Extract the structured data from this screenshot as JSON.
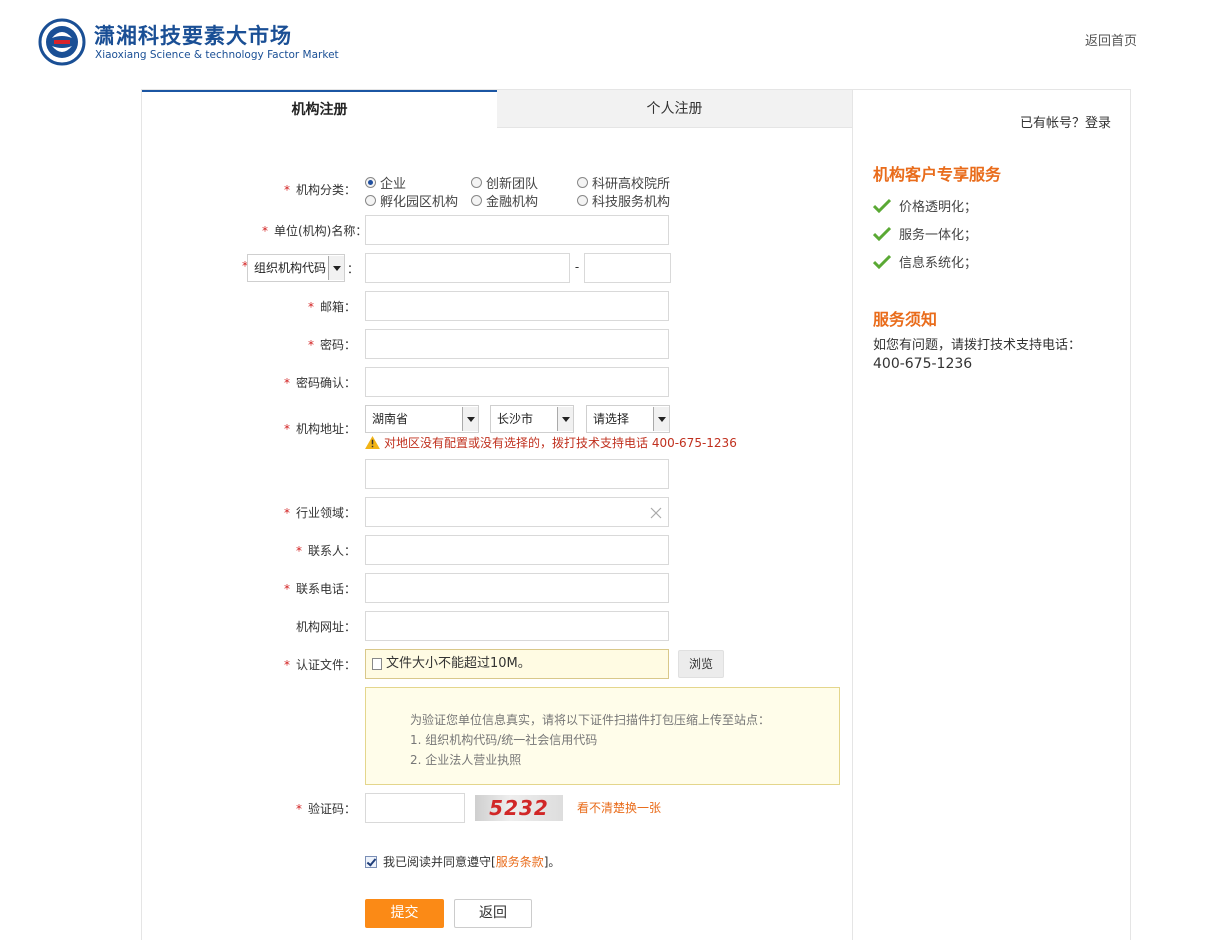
{
  "header": {
    "logo_cn": "潇湘科技要素大市场",
    "logo_en": "Xiaoxiang Science & technology Factor Market",
    "back_home": "返回首页"
  },
  "tabs": [
    {
      "label": "机构注册",
      "active": true
    },
    {
      "label": "个人注册",
      "active": false
    }
  ],
  "form": {
    "required_mark": "*",
    "category": {
      "label": "机构分类：",
      "options": [
        "企业",
        "创新团队",
        "科研高校院所",
        "孵化园区机构",
        "金融机构",
        "科技服务机构"
      ],
      "selected": "企业"
    },
    "unit_name": {
      "label": "单位(机构)名称：",
      "value": ""
    },
    "org_code": {
      "select_value": "组织机构代码",
      "colon": "：",
      "separator": "-",
      "value1": "",
      "value2": ""
    },
    "email": {
      "label": "邮箱：",
      "value": ""
    },
    "password": {
      "label": "密码：",
      "value": ""
    },
    "password_confirm": {
      "label": "密码确认：",
      "value": ""
    },
    "address": {
      "label": "机构地址：",
      "province": "湖南省",
      "city": "长沙市",
      "district": "请选择",
      "warning": "对地区没有配置或没有选择的，拨打技术支持电话 400-675-1236",
      "detail_value": ""
    },
    "industry": {
      "label": "行业领域：",
      "value": ""
    },
    "contact": {
      "label": "联系人：",
      "value": ""
    },
    "phone": {
      "label": "联系电话：",
      "value": ""
    },
    "website": {
      "label": "机构网址：",
      "value": ""
    },
    "cert_file": {
      "label": "认证文件：",
      "placeholder": "文件大小不能超过10M。",
      "browse": "浏览"
    },
    "notice": {
      "line1": "为验证您单位信息真实，请将以下证件扫描件打包压缩上传至站点：",
      "line2": "1. 组织机构代码/统一社会信用代码",
      "line3": "2. 企业法人营业执照"
    },
    "captcha": {
      "label": "验证码：",
      "value": "",
      "image_text": "5232",
      "refresh": "看不清楚换一张"
    },
    "agree": {
      "prefix": "我已阅读并同意遵守[",
      "terms": "服务条款",
      "suffix": "]。",
      "checked": true
    },
    "submit": "提交",
    "back": "返回"
  },
  "sidebar": {
    "login": "已有帐号？登录",
    "service_title": "机构客户专享服务",
    "services": [
      "价格透明化；",
      "服务一体化；",
      "信息系统化；"
    ],
    "notice_title": "服务须知",
    "notice_text": "如您有问题，请拨打技术支持电话：",
    "phone": "400-675-1236"
  },
  "colors": {
    "brand_blue": "#1a4f95",
    "accent_orange": "#e96c1b",
    "button_orange": "#fb8a16",
    "required_red": "#d21f1f"
  }
}
